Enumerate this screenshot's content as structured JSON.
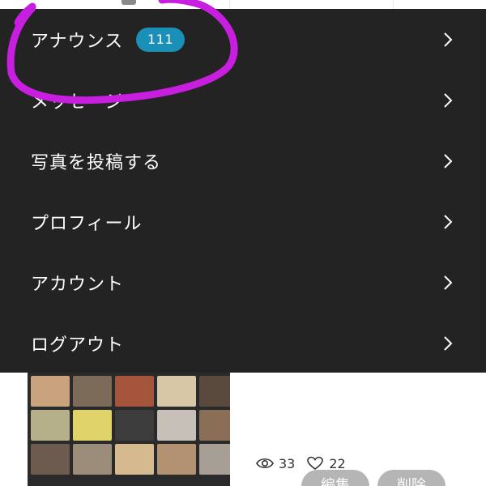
{
  "menu": {
    "items": [
      {
        "label": "アナウンス",
        "badge": "111"
      },
      {
        "label": "メッセージ"
      },
      {
        "label": "写真を投稿する"
      },
      {
        "label": "プロフィール"
      },
      {
        "label": "アカウント"
      },
      {
        "label": "ログアウト"
      }
    ]
  },
  "post": {
    "views": "33",
    "likes": "22",
    "edit_label": "編集",
    "delete_label": "削除"
  },
  "colors": {
    "menu_bg": "#232323",
    "badge_bg": "#1a8fb8",
    "annotation": "#c81ee0"
  }
}
